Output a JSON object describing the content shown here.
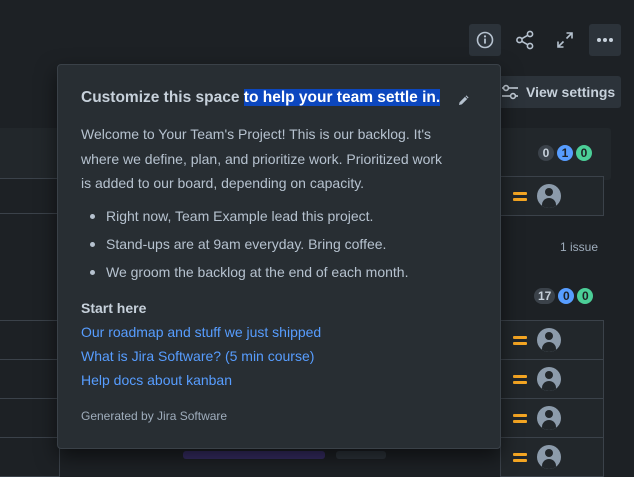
{
  "toolbar": {
    "info_icon": "info-icon",
    "share_icon": "share-icon",
    "expand_icon": "expand-icon",
    "more_icon": "more-icon",
    "view_settings_label": "View settings"
  },
  "board": {
    "column_counts": [
      "0",
      "1",
      "0"
    ],
    "second_group_counts": [
      "17",
      "0",
      "0"
    ],
    "issue_count_label": "1 issue"
  },
  "popup": {
    "title_plain": "Customize this space ",
    "title_highlight": "to help your team settle in.",
    "welcome_text": "Welcome to Your Team's Project! This is our backlog. It's where we define, plan, and prioritize work. Prioritized work is added to our board, depending on capacity.",
    "bullets": [
      "Right now, Team Example lead this project.",
      "Stand-ups are at 9am everyday. Bring coffee.",
      "We groom the backlog at the end of each month."
    ],
    "start_here_label": "Start here",
    "links": [
      "Our roadmap and stuff we just shipped",
      "What is Jira Software? (5 min course)",
      "Help docs about kanban"
    ],
    "footer": "Generated by Jira Software"
  },
  "colors": {
    "background": "#1d2125",
    "popup_bg": "#282e33",
    "link": "#579dff",
    "highlight": "#0c47bf",
    "priority_medium": "#f5a623"
  }
}
